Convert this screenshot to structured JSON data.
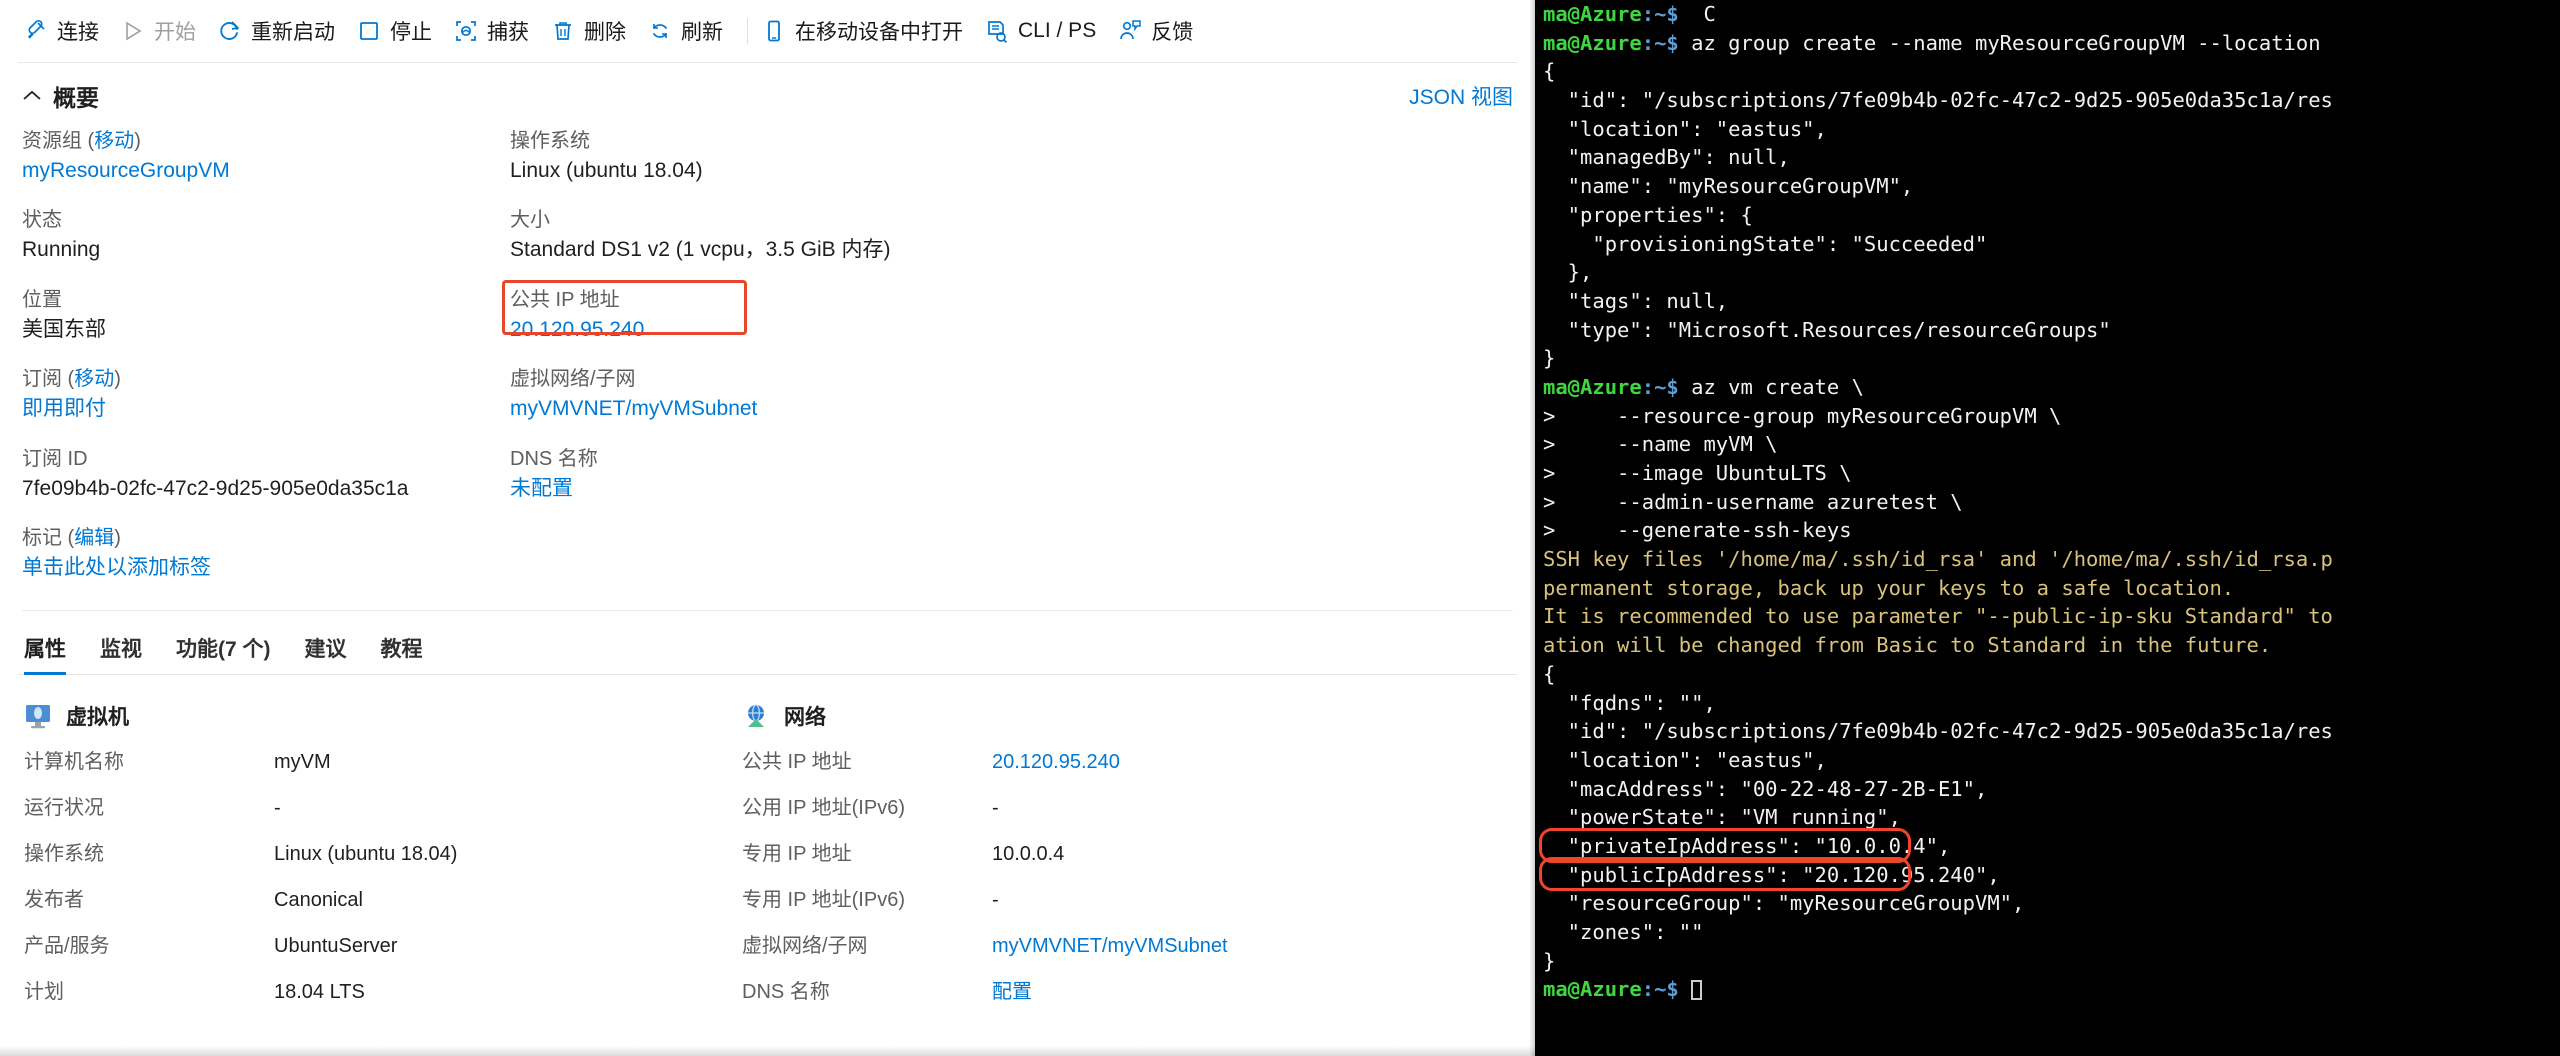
{
  "commandbar": {
    "items": [
      {
        "label": "连接",
        "icon": "connect-icon",
        "disabled": false
      },
      {
        "label": "开始",
        "icon": "start-icon",
        "disabled": true
      },
      {
        "label": "重新启动",
        "icon": "restart-icon",
        "disabled": false
      },
      {
        "label": "停止",
        "icon": "stop-icon",
        "disabled": false
      },
      {
        "label": "捕获",
        "icon": "capture-icon",
        "disabled": false
      },
      {
        "label": "删除",
        "icon": "delete-icon",
        "disabled": false
      },
      {
        "label": "刷新",
        "icon": "refresh-icon",
        "disabled": false
      },
      {
        "label": "在移动设备中打开",
        "icon": "mobile-icon",
        "disabled": false
      },
      {
        "label": "CLI / PS",
        "icon": "cli-icon",
        "disabled": false
      },
      {
        "label": "反馈",
        "icon": "feedback-icon",
        "disabled": false
      }
    ]
  },
  "overview": {
    "title": "概要",
    "json_view": "JSON 视图",
    "left_fields": [
      {
        "label": "资源组",
        "label_link": "移动",
        "value": "myResourceGroupVM",
        "is_link": true
      },
      {
        "label": "状态",
        "label_link": "",
        "value": "Running",
        "is_link": false
      },
      {
        "label": "位置",
        "label_link": "",
        "value": "美国东部",
        "is_link": false
      },
      {
        "label": "订阅",
        "label_link": "移动",
        "value": "即用即付",
        "is_link": true
      },
      {
        "label": "订阅 ID",
        "label_link": "",
        "value": "7fe09b4b-02fc-47c2-9d25-905e0da35c1a",
        "is_link": false
      },
      {
        "label": "标记",
        "label_link": "编辑",
        "value": "单击此处以添加标签",
        "is_link": true
      }
    ],
    "right_fields": [
      {
        "label": "操作系统",
        "label_link": "",
        "value": "Linux (ubuntu 18.04)",
        "is_link": false
      },
      {
        "label": "大小",
        "label_link": "",
        "value": "Standard DS1 v2 (1 vcpu，3.5 GiB 内存)",
        "is_link": false
      },
      {
        "label": "公共 IP 地址",
        "label_link": "",
        "value": "20.120.95.240",
        "is_link": true
      },
      {
        "label": "虚拟网络/子网",
        "label_link": "",
        "value": "myVMVNET/myVMSubnet",
        "is_link": true
      },
      {
        "label": "DNS 名称",
        "label_link": "",
        "value": "未配置",
        "is_link": true
      }
    ],
    "highlight_color": "#e8462c"
  },
  "tabs": [
    {
      "label": "属性",
      "active": true
    },
    {
      "label": "监视",
      "active": false
    },
    {
      "label": "功能(7 个)",
      "active": false
    },
    {
      "label": "建议",
      "active": false
    },
    {
      "label": "教程",
      "active": false
    }
  ],
  "properties": {
    "vm_group": {
      "title": "虚拟机",
      "icon": "virtual-machine-icon",
      "rows": [
        {
          "key": "计算机名称",
          "value": "myVM",
          "is_link": false
        },
        {
          "key": "运行状况",
          "value": "-",
          "is_link": false
        },
        {
          "key": "操作系统",
          "value": "Linux (ubuntu 18.04)",
          "is_link": false
        },
        {
          "key": "发布者",
          "value": "Canonical",
          "is_link": false
        },
        {
          "key": "产品/服务",
          "value": "UbuntuServer",
          "is_link": false
        },
        {
          "key": "计划",
          "value": "18.04 LTS",
          "is_link": false
        }
      ]
    },
    "network_group": {
      "title": "网络",
      "icon": "network-icon",
      "rows": [
        {
          "key": "公共 IP 地址",
          "value": "20.120.95.240",
          "is_link": true
        },
        {
          "key": "公用 IP 地址(IPv6)",
          "value": "-",
          "is_link": false
        },
        {
          "key": "专用 IP 地址",
          "value": "10.0.0.4",
          "is_link": false
        },
        {
          "key": "专用 IP 地址(IPv6)",
          "value": "-",
          "is_link": false
        },
        {
          "key": "虚拟网络/子网",
          "value": "myVMVNET/myVMSubnet",
          "is_link": true
        },
        {
          "key": "DNS 名称",
          "value": "配置",
          "is_link": true
        }
      ]
    }
  },
  "terminal": {
    "prompt_user": "ma@Azure",
    "prompt_path": ":~$",
    "lines": [
      {
        "segments": [
          {
            "t": "ma@Azure",
            "c": "g"
          },
          {
            "t": ":~$",
            "c": "b"
          },
          {
            "t": "  C",
            "c": "w"
          }
        ]
      },
      {
        "segments": [
          {
            "t": "ma@Azure",
            "c": "g"
          },
          {
            "t": ":~$",
            "c": "b"
          },
          {
            "t": " az group create --name myResourceGroupVM --location ",
            "c": "w"
          }
        ]
      },
      {
        "segments": [
          {
            "t": "{",
            "c": "w"
          }
        ]
      },
      {
        "segments": [
          {
            "t": "  \"id\": \"/subscriptions/7fe09b4b-02fc-47c2-9d25-905e0da35c1a/res",
            "c": "w"
          }
        ]
      },
      {
        "segments": [
          {
            "t": "  \"location\": \"eastus\",",
            "c": "w"
          }
        ]
      },
      {
        "segments": [
          {
            "t": "  \"managedBy\": null,",
            "c": "w"
          }
        ]
      },
      {
        "segments": [
          {
            "t": "  \"name\": \"myResourceGroupVM\",",
            "c": "w"
          }
        ]
      },
      {
        "segments": [
          {
            "t": "  \"properties\": {",
            "c": "w"
          }
        ]
      },
      {
        "segments": [
          {
            "t": "    \"provisioningState\": \"Succeeded\"",
            "c": "w"
          }
        ]
      },
      {
        "segments": [
          {
            "t": "  },",
            "c": "w"
          }
        ]
      },
      {
        "segments": [
          {
            "t": "  \"tags\": null,",
            "c": "w"
          }
        ]
      },
      {
        "segments": [
          {
            "t": "  \"type\": \"Microsoft.Resources/resourceGroups\"",
            "c": "w"
          }
        ]
      },
      {
        "segments": [
          {
            "t": "}",
            "c": "w"
          }
        ]
      },
      {
        "segments": [
          {
            "t": "ma@Azure",
            "c": "g"
          },
          {
            "t": ":~$",
            "c": "b"
          },
          {
            "t": " az vm create \\",
            "c": "w"
          }
        ]
      },
      {
        "segments": [
          {
            "t": ">     --resource-group myResourceGroupVM \\",
            "c": "w"
          }
        ]
      },
      {
        "segments": [
          {
            "t": ">     --name myVM \\",
            "c": "w"
          }
        ]
      },
      {
        "segments": [
          {
            "t": ">     --image UbuntuLTS \\",
            "c": "w"
          }
        ]
      },
      {
        "segments": [
          {
            "t": ">     --admin-username azuretest \\",
            "c": "w"
          }
        ]
      },
      {
        "segments": [
          {
            "t": ">     --generate-ssh-keys",
            "c": "w"
          }
        ]
      },
      {
        "segments": [
          {
            "t": "SSH key files '/home/ma/.ssh/id_rsa' and '/home/ma/.ssh/id_rsa.p",
            "c": "y"
          }
        ]
      },
      {
        "segments": [
          {
            "t": "permanent storage, back up your keys to a safe location.",
            "c": "y"
          }
        ]
      },
      {
        "segments": [
          {
            "t": "It is recommended to use parameter \"--public-ip-sku Standard\" to",
            "c": "y"
          }
        ]
      },
      {
        "segments": [
          {
            "t": "ation will be changed from Basic to Standard in the future.",
            "c": "y"
          }
        ]
      },
      {
        "segments": [
          {
            "t": "{",
            "c": "w"
          }
        ]
      },
      {
        "segments": [
          {
            "t": "  \"fqdns\": \"\",",
            "c": "w"
          }
        ]
      },
      {
        "segments": [
          {
            "t": "  \"id\": \"/subscriptions/7fe09b4b-02fc-47c2-9d25-905e0da35c1a/res",
            "c": "w"
          }
        ]
      },
      {
        "segments": [
          {
            "t": "  \"location\": \"eastus\",",
            "c": "w"
          }
        ]
      },
      {
        "segments": [
          {
            "t": "  \"macAddress\": \"00-22-48-27-2B-E1\",",
            "c": "w"
          }
        ]
      },
      {
        "segments": [
          {
            "t": "  \"powerState\": \"VM running\",",
            "c": "w"
          }
        ]
      },
      {
        "segments": [
          {
            "t": "  \"privateIpAddress\": \"10.0.0.4\",",
            "c": "w"
          }
        ]
      },
      {
        "segments": [
          {
            "t": "  \"publicIpAddress\": \"20.120.95.240\",",
            "c": "w"
          }
        ]
      },
      {
        "segments": [
          {
            "t": "  \"resourceGroup\": \"myResourceGroupVM\",",
            "c": "w"
          }
        ]
      },
      {
        "segments": [
          {
            "t": "  \"zones\": \"\"",
            "c": "w"
          }
        ]
      },
      {
        "segments": [
          {
            "t": "}",
            "c": "w"
          }
        ]
      },
      {
        "segments": [
          {
            "t": "ma@Azure",
            "c": "g"
          },
          {
            "t": ":~$",
            "c": "b"
          },
          {
            "t": " ",
            "c": "w"
          },
          {
            "t": "\u0000CURSOR",
            "c": "cur"
          }
        ]
      }
    ],
    "highlight_color": "#f0452a"
  }
}
